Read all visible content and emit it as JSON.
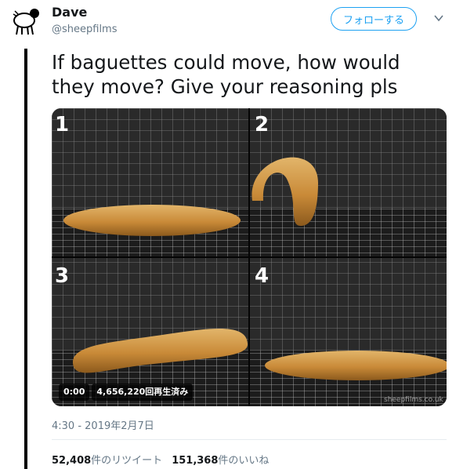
{
  "author": {
    "name": "Dave",
    "handle": "@sheepfilms"
  },
  "follow_button": {
    "label": "フォローする"
  },
  "tweet": {
    "text_line1": "If baguettes could move, how would",
    "text_line2": "they move? Give your reasoning pls"
  },
  "media": {
    "panels": [
      "1",
      "2",
      "3",
      "4"
    ],
    "video_time": "0:00",
    "view_count": "4,656,220回再生済み",
    "watermark": "sheepfilms.co.uk"
  },
  "timestamp": "4:30 - 2019年2月7日",
  "stats": {
    "retweets_count": "52,408",
    "retweets_label": "件のリツイート",
    "likes_count": "151,368",
    "likes_label": "件のいいね"
  },
  "colors": {
    "accent": "#1da1f2",
    "secondary_text": "#657786",
    "divider": "#e6ecf0"
  },
  "icons": {
    "avatar": "sheep-avatar",
    "menu": "chevron-down-icon"
  }
}
